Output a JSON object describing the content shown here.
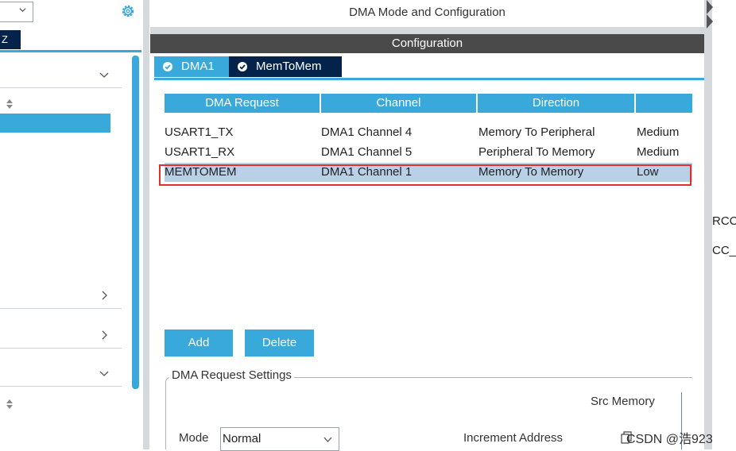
{
  "sidebar": {
    "az_button_label": "Z",
    "icons": {
      "gear": "gear-icon",
      "dropdown_chevron": "chevron-down-icon",
      "sort": "sort-icon",
      "expand": "chevron-right-icon",
      "collapse": "chevron-down-icon"
    }
  },
  "header": {
    "title": "DMA Mode and Configuration",
    "configuration_label": "Configuration"
  },
  "tabs": [
    {
      "label": "DMA1",
      "active": true
    },
    {
      "label": "MemToMem",
      "active": false
    }
  ],
  "table": {
    "columns": [
      "DMA Request",
      "Channel",
      "Direction",
      ""
    ],
    "rows": [
      {
        "request": "USART1_TX",
        "channel": "DMA1 Channel 4",
        "direction": "Memory To Peripheral",
        "priority": "Medium",
        "selected": false
      },
      {
        "request": "USART1_RX",
        "channel": "DMA1 Channel 5",
        "direction": "Peripheral To Memory",
        "priority": "Medium",
        "selected": false
      },
      {
        "request": "MEMTOMEM",
        "channel": "DMA1 Channel 1",
        "direction": "Memory To Memory",
        "priority": "Low",
        "selected": true
      }
    ]
  },
  "buttons": {
    "add": "Add",
    "delete": "Delete"
  },
  "settings": {
    "title": "DMA Request Settings",
    "src_memory_label": "Src Memory",
    "mode_label": "Mode",
    "mode_value": "Normal",
    "increment_address_label": "Increment Address"
  },
  "right_strip": {
    "clipped_text_1": "RCC",
    "clipped_text_2": "CC_("
  },
  "watermark": "CSDN @浩923",
  "colors": {
    "accent_blue": "#39a9dc",
    "dark_navy": "#03234b",
    "config_bar": "#4a4a4a",
    "selected_row": "#b9d1e6",
    "highlight_border": "#e0302c"
  }
}
